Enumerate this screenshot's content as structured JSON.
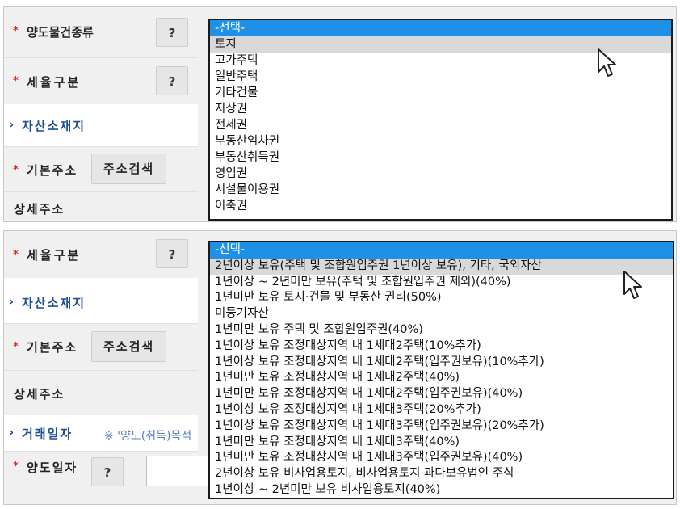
{
  "panel1": {
    "labels": {
      "transfer_type": "양도물건종류",
      "tax_class": "세율구분",
      "asset_location": "자산소재지",
      "basic_address": "기본주소",
      "detail_address": "상세주소"
    },
    "help_button": "?",
    "address_search_button": "주소검색",
    "dropdown": {
      "options": [
        "-선택-",
        "토지",
        "고가주택",
        "일반주택",
        "기타건물",
        "지상권",
        "전세권",
        "부동산임차권",
        "부동산취득권",
        "영업권",
        "시설물이용권",
        "이축권"
      ]
    }
  },
  "panel2": {
    "labels": {
      "tax_class": "세율구분",
      "asset_location": "자산소재지",
      "basic_address": "기본주소",
      "detail_address": "상세주소",
      "trade_date": "거래일자",
      "transfer_date": "양도일자"
    },
    "help_button": "?",
    "address_search_button": "주소검색",
    "trade_date_note": "※ '양도(취득)목적",
    "dropdown": {
      "options": [
        "-선택-",
        "2년이상 보유(주택 및 조합원입주권 1년이상 보유), 기타, 국외자산",
        "1년이상 ~ 2년미만 보유(주택 및 조합원입주권 제외)(40%)",
        "1년미만 보유 토지·건물 및 부동산 권리(50%)",
        "미등기자산",
        "1년미만 보유 주택 및 조합원입주권(40%)",
        "1년이상 보유 조정대상지역 내 1세대2주택(10%추가)",
        "1년이상 보유 조정대상지역 내 1세대2주택(입주권보유)(10%추가)",
        "1년미만 보유 조정대상지역 내 1세대2주택(40%)",
        "1년미만 보유 조정대상지역 내 1세대2주택(입주권보유)(40%)",
        "1년이상 보유 조정대상지역 내 1세대3주택(20%추가)",
        "1년이상 보유 조정대상지역 내 1세대3주택(입주권보유)(20%추가)",
        "1년미만 보유 조정대상지역 내 1세대3주택(40%)",
        "1년미만 보유 조정대상지역 내 1세대3주택(입주권보유)(40%)",
        "2년이상 보유 비사업용토지, 비사업용토지 과다보유법인 주식",
        "1년이상 ~ 2년미만 보유 비사업용토지(40%)"
      ]
    }
  },
  "colors": {
    "selected_option": "#1e90e6",
    "hover_option": "#d9d9d9",
    "required_star": "#d7261e",
    "section_blue": "#1d4f91"
  }
}
